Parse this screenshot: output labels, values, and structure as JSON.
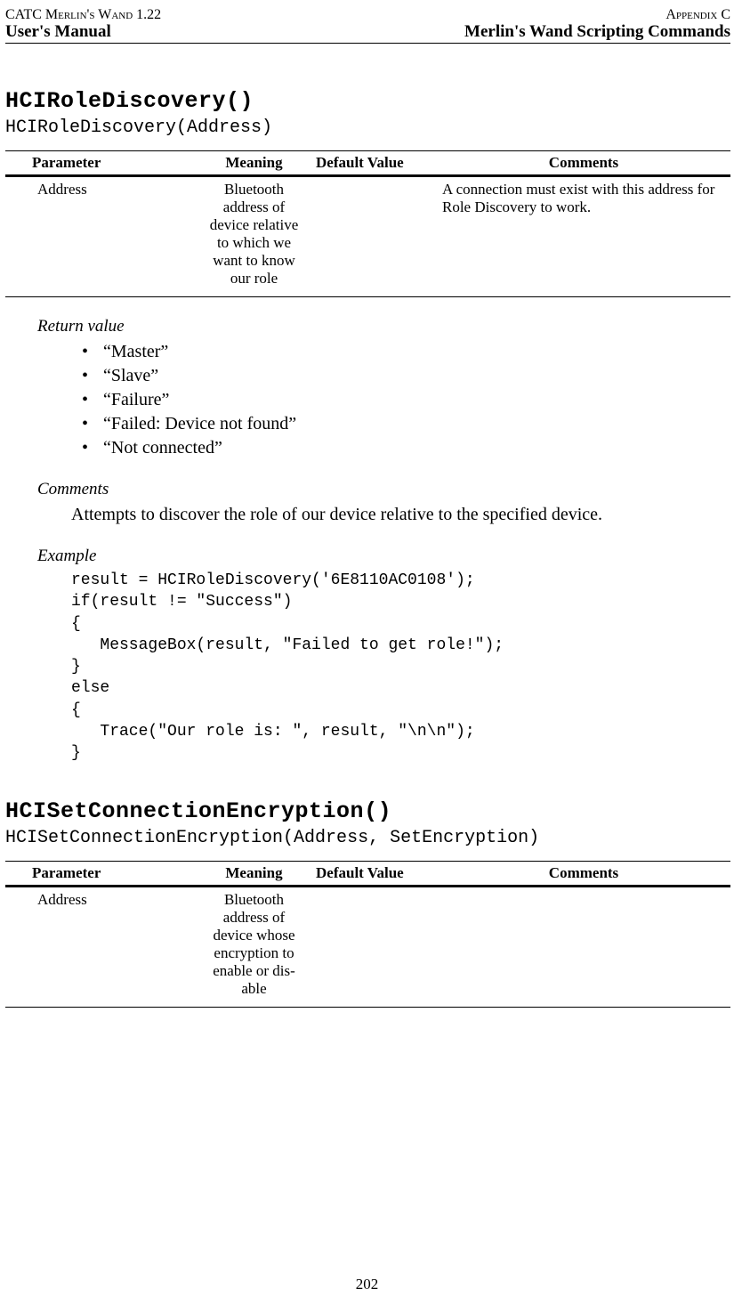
{
  "header": {
    "left_top": "CATC Merlin's Wand 1.22",
    "right_top": "Appendix C",
    "left_sub": "User's Manual",
    "right_sub": "Merlin's Wand Scripting Commands"
  },
  "section1": {
    "title": "HCIRoleDiscovery()",
    "signature": "HCIRoleDiscovery(Address)",
    "table": {
      "headers": {
        "parameter": "Parameter",
        "meaning": "Meaning",
        "default": "Default Value",
        "comments": "Comments"
      },
      "rows": [
        {
          "parameter": "Address",
          "meaning": "Bluetooth address of device rela­tive to which we want to know our role",
          "default": "",
          "comments": "A connection must exist with this address for Role Discovery to work."
        }
      ]
    },
    "return_label": "Return value",
    "returns": [
      "“Master”",
      "“Slave”",
      "“Failure”",
      "“Failed: Device not found”",
      "“Not connected”"
    ],
    "comments_label": "Comments",
    "comments_body": "Attempts to discover the role of our device relative to the specified device.",
    "example_label": "Example",
    "example_code": "result = HCIRoleDiscovery('6E8110AC0108');\nif(result != \"Success\")\n{\n   MessageBox(result, \"Failed to get role!\");\n}\nelse\n{\n   Trace(\"Our role is: \", result, \"\\n\\n\");\n}"
  },
  "section2": {
    "title": "HCISetConnectionEncryption()",
    "signature": "HCISetConnectionEncryption(Address, SetEncryption)",
    "table": {
      "headers": {
        "parameter": "Parameter",
        "meaning": "Meaning",
        "default": "Default Value",
        "comments": "Comments"
      },
      "rows": [
        {
          "parameter": "Address",
          "meaning": "Bluetooth address of device whose encryption to enable or dis­able",
          "default": "",
          "comments": ""
        }
      ]
    }
  },
  "page_number": "202"
}
